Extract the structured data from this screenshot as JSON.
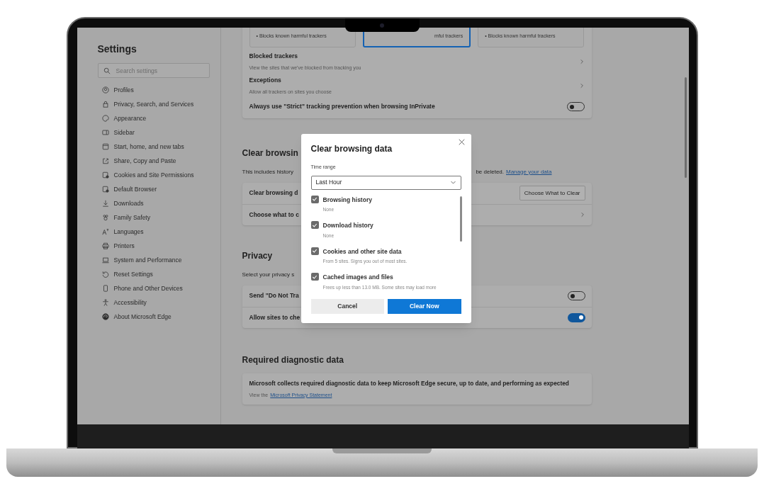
{
  "sidebar": {
    "title": "Settings",
    "search": {
      "placeholder": "Search settings"
    },
    "items": [
      {
        "label": "Profiles",
        "kind": "profile",
        "selected": false
      },
      {
        "label": "Privacy, Search, and Services",
        "kind": "lock",
        "selected": false
      },
      {
        "label": "Appearance",
        "kind": "palette",
        "selected": false
      },
      {
        "label": "Sidebar",
        "kind": "sidebar",
        "selected": false
      },
      {
        "label": "Start, home, and new tabs",
        "kind": "window",
        "selected": false
      },
      {
        "label": "Share, Copy and Paste",
        "kind": "share",
        "selected": false
      },
      {
        "label": "Cookies and Site Permissions",
        "kind": "cookies",
        "selected": false
      },
      {
        "label": "Default Browser",
        "kind": "browser",
        "selected": false
      },
      {
        "label": "Downloads",
        "kind": "download",
        "selected": false
      },
      {
        "label": "Family Safety",
        "kind": "family",
        "selected": false
      },
      {
        "label": "Languages",
        "kind": "language",
        "selected": false
      },
      {
        "label": "Printers",
        "kind": "printer",
        "selected": false
      },
      {
        "label": "System and Performance",
        "kind": "laptop",
        "selected": false
      },
      {
        "label": "Reset Settings",
        "kind": "reset",
        "selected": false
      },
      {
        "label": "Phone and Other Devices",
        "kind": "phone",
        "selected": false
      },
      {
        "label": "Accessibility",
        "kind": "accessibility",
        "selected": false
      },
      {
        "label": "About Microsoft Edge",
        "kind": "swirl",
        "selected": false
      }
    ]
  },
  "tracking_cards": [
    {
      "text": "•  Blocks known harmful trackers",
      "selected": false
    },
    {
      "text": "mful trackers",
      "selected": true
    },
    {
      "text": "•  Blocks known harmful trackers",
      "selected": false
    }
  ],
  "tracking_rows": [
    {
      "kind": "link",
      "title": "Blocked trackers",
      "description": "View the sites that we've blocked from tracking you"
    },
    {
      "kind": "link",
      "title": "Exceptions",
      "description": "Allow all trackers on sites you choose"
    },
    {
      "kind": "toggle",
      "title": "Always use \"Strict\" tracking prevention when browsing InPrivate",
      "on": false
    }
  ],
  "clear_section": {
    "heading": "Clear browsin",
    "description_start": "This includes history",
    "description_end": "be deleted.",
    "link": "Manage your data",
    "rows": [
      {
        "kind": "button",
        "title": "Clear browsing d",
        "button": "Choose What to Clear"
      },
      {
        "kind": "link",
        "title": "Choose what to c"
      }
    ]
  },
  "privacy": {
    "heading": "Privacy",
    "description": "Select your privacy s",
    "rows": [
      {
        "kind": "toggle",
        "title": "Send \"Do Not Tra",
        "on": false
      },
      {
        "kind": "toggle",
        "title": "Allow sites to che",
        "on": true
      }
    ]
  },
  "diagnostic": {
    "heading": "Required diagnostic data",
    "text": "Microsoft collects required diagnostic data to keep Microsoft Edge secure, up to date, and performing as expected",
    "note": "View the",
    "link": "Microsoft Privacy Statement"
  },
  "dialog": {
    "title": "Clear browsing data",
    "time_range_label": "Time range",
    "time_range": "Last Hour",
    "options": [
      {
        "label": "Browsing history",
        "detail": "None",
        "checked": true
      },
      {
        "label": "Download history",
        "detail": "None",
        "checked": true
      },
      {
        "label": "Cookies and other site data",
        "detail": "From 5 sites. Signs you out of most sites.",
        "checked": true
      },
      {
        "label": "Cached images and files",
        "detail": "Frees up less than 13.0 MB. Some sites may load more",
        "checked": true
      }
    ],
    "cancel": "Cancel",
    "confirm": "Clear Now"
  }
}
